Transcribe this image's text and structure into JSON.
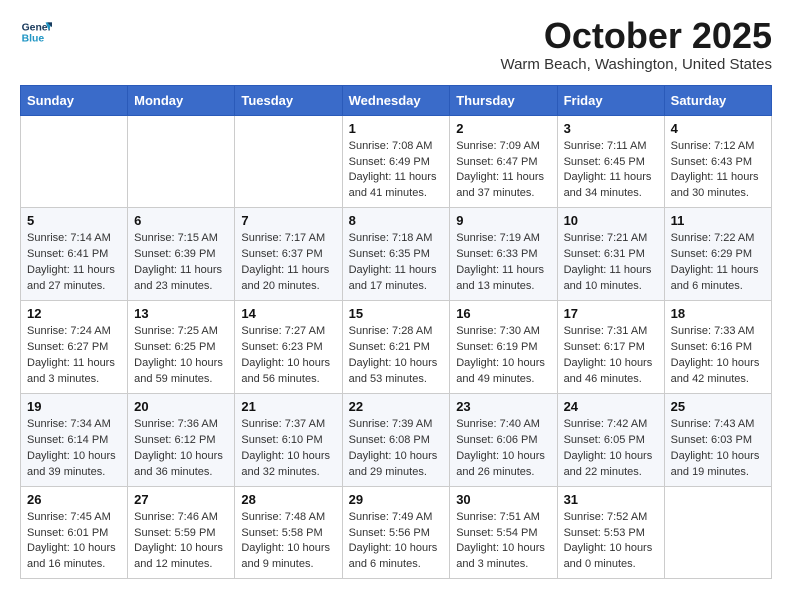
{
  "logo": {
    "line1": "General",
    "line2": "Blue"
  },
  "title": "October 2025",
  "location": "Warm Beach, Washington, United States",
  "days_of_week": [
    "Sunday",
    "Monday",
    "Tuesday",
    "Wednesday",
    "Thursday",
    "Friday",
    "Saturday"
  ],
  "weeks": [
    [
      {
        "day": "",
        "info": ""
      },
      {
        "day": "",
        "info": ""
      },
      {
        "day": "",
        "info": ""
      },
      {
        "day": "1",
        "info": "Sunrise: 7:08 AM\nSunset: 6:49 PM\nDaylight: 11 hours\nand 41 minutes."
      },
      {
        "day": "2",
        "info": "Sunrise: 7:09 AM\nSunset: 6:47 PM\nDaylight: 11 hours\nand 37 minutes."
      },
      {
        "day": "3",
        "info": "Sunrise: 7:11 AM\nSunset: 6:45 PM\nDaylight: 11 hours\nand 34 minutes."
      },
      {
        "day": "4",
        "info": "Sunrise: 7:12 AM\nSunset: 6:43 PM\nDaylight: 11 hours\nand 30 minutes."
      }
    ],
    [
      {
        "day": "5",
        "info": "Sunrise: 7:14 AM\nSunset: 6:41 PM\nDaylight: 11 hours\nand 27 minutes."
      },
      {
        "day": "6",
        "info": "Sunrise: 7:15 AM\nSunset: 6:39 PM\nDaylight: 11 hours\nand 23 minutes."
      },
      {
        "day": "7",
        "info": "Sunrise: 7:17 AM\nSunset: 6:37 PM\nDaylight: 11 hours\nand 20 minutes."
      },
      {
        "day": "8",
        "info": "Sunrise: 7:18 AM\nSunset: 6:35 PM\nDaylight: 11 hours\nand 17 minutes."
      },
      {
        "day": "9",
        "info": "Sunrise: 7:19 AM\nSunset: 6:33 PM\nDaylight: 11 hours\nand 13 minutes."
      },
      {
        "day": "10",
        "info": "Sunrise: 7:21 AM\nSunset: 6:31 PM\nDaylight: 11 hours\nand 10 minutes."
      },
      {
        "day": "11",
        "info": "Sunrise: 7:22 AM\nSunset: 6:29 PM\nDaylight: 11 hours\nand 6 minutes."
      }
    ],
    [
      {
        "day": "12",
        "info": "Sunrise: 7:24 AM\nSunset: 6:27 PM\nDaylight: 11 hours\nand 3 minutes."
      },
      {
        "day": "13",
        "info": "Sunrise: 7:25 AM\nSunset: 6:25 PM\nDaylight: 10 hours\nand 59 minutes."
      },
      {
        "day": "14",
        "info": "Sunrise: 7:27 AM\nSunset: 6:23 PM\nDaylight: 10 hours\nand 56 minutes."
      },
      {
        "day": "15",
        "info": "Sunrise: 7:28 AM\nSunset: 6:21 PM\nDaylight: 10 hours\nand 53 minutes."
      },
      {
        "day": "16",
        "info": "Sunrise: 7:30 AM\nSunset: 6:19 PM\nDaylight: 10 hours\nand 49 minutes."
      },
      {
        "day": "17",
        "info": "Sunrise: 7:31 AM\nSunset: 6:17 PM\nDaylight: 10 hours\nand 46 minutes."
      },
      {
        "day": "18",
        "info": "Sunrise: 7:33 AM\nSunset: 6:16 PM\nDaylight: 10 hours\nand 42 minutes."
      }
    ],
    [
      {
        "day": "19",
        "info": "Sunrise: 7:34 AM\nSunset: 6:14 PM\nDaylight: 10 hours\nand 39 minutes."
      },
      {
        "day": "20",
        "info": "Sunrise: 7:36 AM\nSunset: 6:12 PM\nDaylight: 10 hours\nand 36 minutes."
      },
      {
        "day": "21",
        "info": "Sunrise: 7:37 AM\nSunset: 6:10 PM\nDaylight: 10 hours\nand 32 minutes."
      },
      {
        "day": "22",
        "info": "Sunrise: 7:39 AM\nSunset: 6:08 PM\nDaylight: 10 hours\nand 29 minutes."
      },
      {
        "day": "23",
        "info": "Sunrise: 7:40 AM\nSunset: 6:06 PM\nDaylight: 10 hours\nand 26 minutes."
      },
      {
        "day": "24",
        "info": "Sunrise: 7:42 AM\nSunset: 6:05 PM\nDaylight: 10 hours\nand 22 minutes."
      },
      {
        "day": "25",
        "info": "Sunrise: 7:43 AM\nSunset: 6:03 PM\nDaylight: 10 hours\nand 19 minutes."
      }
    ],
    [
      {
        "day": "26",
        "info": "Sunrise: 7:45 AM\nSunset: 6:01 PM\nDaylight: 10 hours\nand 16 minutes."
      },
      {
        "day": "27",
        "info": "Sunrise: 7:46 AM\nSunset: 5:59 PM\nDaylight: 10 hours\nand 12 minutes."
      },
      {
        "day": "28",
        "info": "Sunrise: 7:48 AM\nSunset: 5:58 PM\nDaylight: 10 hours\nand 9 minutes."
      },
      {
        "day": "29",
        "info": "Sunrise: 7:49 AM\nSunset: 5:56 PM\nDaylight: 10 hours\nand 6 minutes."
      },
      {
        "day": "30",
        "info": "Sunrise: 7:51 AM\nSunset: 5:54 PM\nDaylight: 10 hours\nand 3 minutes."
      },
      {
        "day": "31",
        "info": "Sunrise: 7:52 AM\nSunset: 5:53 PM\nDaylight: 10 hours\nand 0 minutes."
      },
      {
        "day": "",
        "info": ""
      }
    ]
  ]
}
